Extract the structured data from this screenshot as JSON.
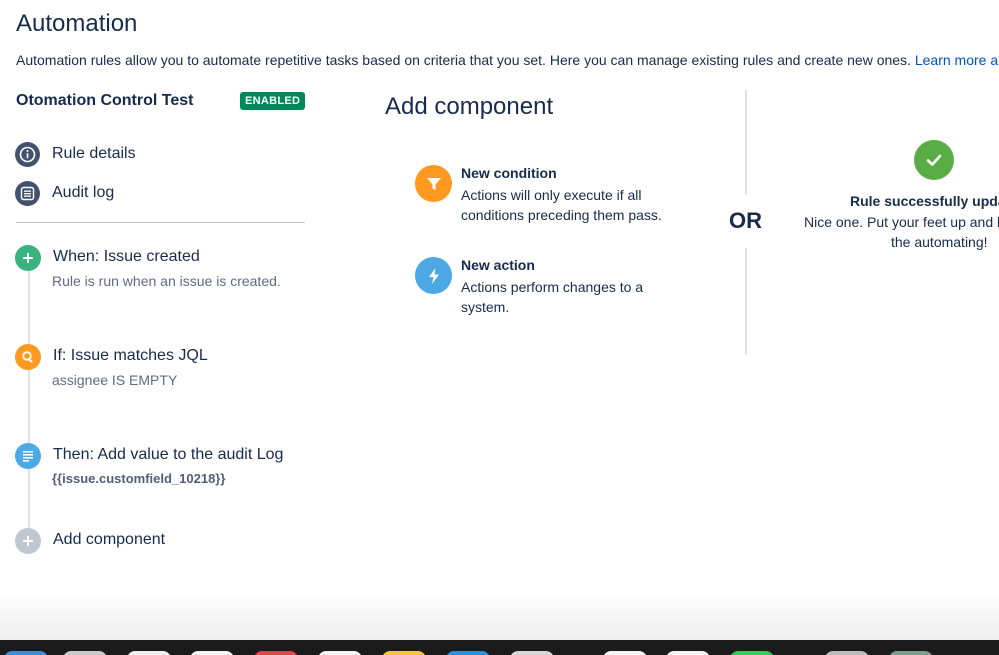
{
  "page": {
    "title": "Automation",
    "intro": "Automation rules allow you to automate repetitive tasks based on criteria that you set. Here you can manage existing rules and create new ones.",
    "learn_more": "Learn more ab"
  },
  "rule": {
    "name": "Otomation Control Test",
    "status": "ENABLED"
  },
  "nav": {
    "rule_details": "Rule details",
    "audit_log": "Audit log"
  },
  "steps": [
    {
      "title": "When: Issue created",
      "desc": "Rule is run when an issue is created.",
      "color": "#36b37e",
      "icon": "plus-icon"
    },
    {
      "title": "If: Issue matches JQL",
      "desc": "assignee IS EMPTY",
      "color": "#ff991f",
      "icon": "search-icon"
    },
    {
      "title": "Then: Add value to the audit Log",
      "desc": "{{issue.customfield_10218}}",
      "color": "#4ca9e6",
      "icon": "document-icon"
    },
    {
      "title": "Add component",
      "desc": "",
      "color": "#c1c7d0",
      "icon": "plus-icon"
    }
  ],
  "panel": {
    "title": "Add component",
    "condition_title": "New condition",
    "condition_desc": "Actions will only execute if all conditions preceding them pass.",
    "action_title": "New action",
    "action_desc": "Actions perform changes to a system.",
    "or": "OR"
  },
  "success": {
    "title": "Rule successfully upda",
    "line1": "Nice one. Put your feet up and l",
    "line2": "the automating!"
  },
  "colors": {
    "enabled": "#00875a",
    "condition": "#ff991f",
    "action": "#4ca9e6",
    "success": "#5aac44",
    "link": "#0052cc"
  }
}
